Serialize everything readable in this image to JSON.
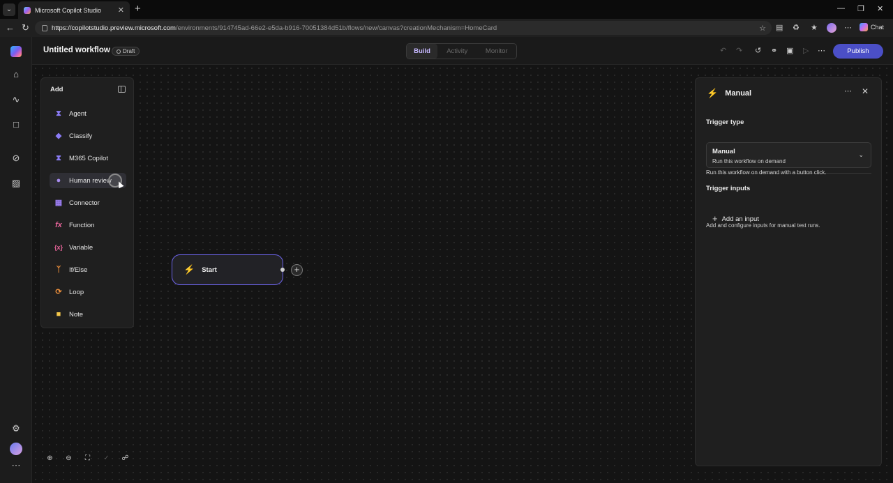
{
  "browser": {
    "tab_title": "Microsoft Copilot Studio",
    "url_host": "https://copilotstudio.preview.microsoft.com",
    "url_path": "/environments/914745ad-66e2-e5da-b916-70051384d51b/flows/new/canvas?creationMechanism=HomeCard",
    "chat_label": "Chat"
  },
  "header": {
    "title": "Untitled workflow",
    "status": "Draft",
    "tabs": [
      {
        "label": "Build",
        "active": true
      },
      {
        "label": "Activity",
        "active": false
      },
      {
        "label": "Monitor",
        "active": false
      }
    ],
    "publish_label": "Publish"
  },
  "add_panel": {
    "title": "Add",
    "items": [
      {
        "label": "Agent",
        "icon": "agent-icon",
        "color": "#8b7cf6"
      },
      {
        "label": "Classify",
        "icon": "classify-icon",
        "color": "#8b7cf6"
      },
      {
        "label": "M365 Copilot",
        "icon": "m365-copilot-icon",
        "color": "#8b7cf6"
      },
      {
        "label": "Human review",
        "icon": "human-review-icon",
        "color": "#a88cf0"
      },
      {
        "label": "Connector",
        "icon": "connector-icon",
        "color": "#9a7cf0"
      },
      {
        "label": "Function",
        "icon": "function-icon",
        "color": "#e8649a"
      },
      {
        "label": "Variable",
        "icon": "variable-icon",
        "color": "#e8649a"
      },
      {
        "label": "If/Else",
        "icon": "if-else-icon",
        "color": "#f0913c"
      },
      {
        "label": "Loop",
        "icon": "loop-icon",
        "color": "#f0913c"
      },
      {
        "label": "Note",
        "icon": "note-icon",
        "color": "#f5c84a"
      }
    ]
  },
  "canvas": {
    "start_node_label": "Start"
  },
  "properties": {
    "title": "Manual",
    "trigger_type_label": "Trigger type",
    "trigger_value": "Manual",
    "trigger_description": "Run this workflow on demand",
    "trigger_help": "Run this workflow on demand with a button click.",
    "trigger_inputs_label": "Trigger inputs",
    "add_input_label": "Add an input",
    "inputs_help": "Add and configure inputs for manual test runs."
  },
  "colors": {
    "accent": "#6c63e8",
    "publish": "#4b4fc7",
    "trigger_green": "#2ed47a"
  }
}
